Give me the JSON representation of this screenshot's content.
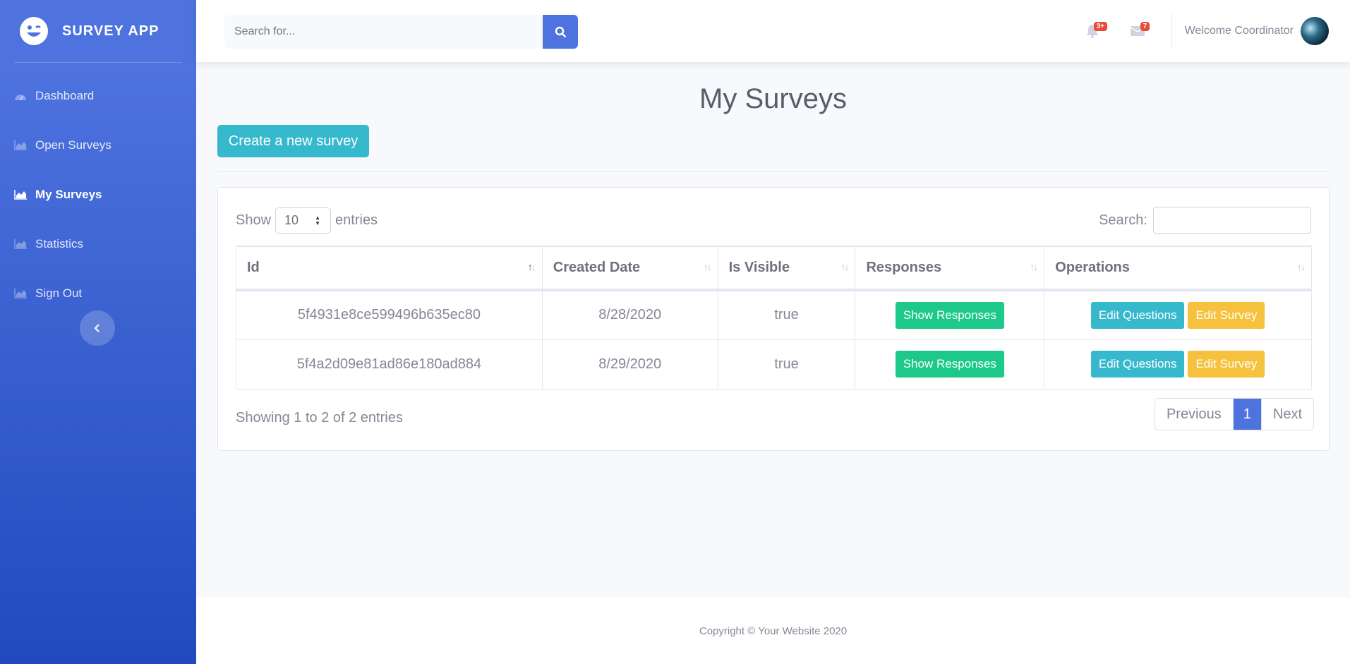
{
  "brand": {
    "name": "SURVEY APP",
    "logo_icon": "laugh-wink-icon"
  },
  "sidebar": {
    "items": [
      {
        "label": "Dashboard",
        "icon": "tachometer-icon",
        "active": false
      },
      {
        "label": "Open Surveys",
        "icon": "chart-area-icon",
        "active": false
      },
      {
        "label": "My Surveys",
        "icon": "chart-area-icon",
        "active": true
      },
      {
        "label": "Statistics",
        "icon": "chart-area-icon",
        "active": false
      },
      {
        "label": "Sign Out",
        "icon": "chart-area-icon",
        "active": false
      }
    ],
    "toggle_icon": "chevron-left-icon"
  },
  "topbar": {
    "search_placeholder": "Search for...",
    "alerts_badge": "3+",
    "messages_badge": "7",
    "welcome_text": "Welcome Coordinator"
  },
  "main": {
    "title": "My Surveys",
    "create_button": "Create a new survey",
    "show_label": "Show",
    "entries_label": "entries",
    "page_length": "10",
    "search_label": "Search:",
    "columns": [
      "Id",
      "Created Date",
      "Is Visible",
      "Responses",
      "Operations"
    ],
    "rows": [
      {
        "id": "5f4931e8ce599496b635ec80",
        "created": "8/28/2020",
        "visible": "true"
      },
      {
        "id": "5f4a2d09e81ad86e180ad884",
        "created": "8/29/2020",
        "visible": "true"
      }
    ],
    "row_buttons": {
      "responses": "Show Responses",
      "edit_questions": "Edit Questions",
      "edit_survey": "Edit Survey"
    },
    "info_text": "Showing 1 to 2 of 2 entries",
    "pagination": {
      "previous": "Previous",
      "current": "1",
      "next": "Next"
    }
  },
  "footer": {
    "copyright": "Copyright © Your Website 2020"
  },
  "colors": {
    "primary": "#4e73df",
    "info": "#36b9cc",
    "success": "#1cc88a",
    "warning": "#f6c23e",
    "danger": "#e74a3b"
  }
}
